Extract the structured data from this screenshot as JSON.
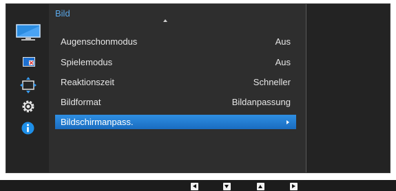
{
  "menu": {
    "title": "Bild",
    "items": [
      {
        "label": "Augenschonmodus",
        "value": "Aus",
        "selected": false
      },
      {
        "label": "Spielemodus",
        "value": "Aus",
        "selected": false
      },
      {
        "label": "Reaktionszeit",
        "value": "Schneller",
        "selected": false
      },
      {
        "label": "Bildformat",
        "value": "Bildanpassung",
        "selected": false
      },
      {
        "label": "Bildschirmanpass.",
        "value": "",
        "selected": true
      }
    ]
  },
  "sidebar": {
    "icons": [
      "picture-icon",
      "color-icon",
      "size-position-icon",
      "settings-gear-icon",
      "info-icon"
    ]
  },
  "bottom_nav": {
    "buttons": [
      "left-arrow-icon",
      "down-arrow-icon",
      "up-arrow-icon",
      "right-arrow-icon"
    ]
  },
  "colors": {
    "accent": "#2f8fe3",
    "title": "#5aa7e8",
    "info": "#1e8fe8"
  }
}
